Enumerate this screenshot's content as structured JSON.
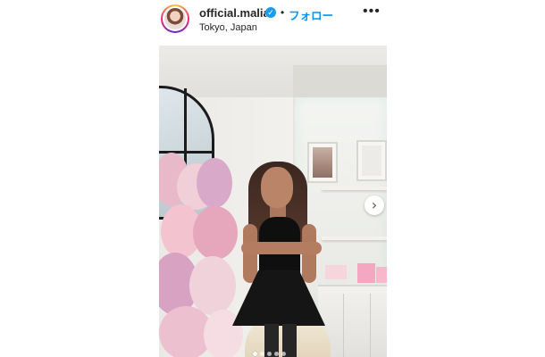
{
  "post_header": {
    "username": "official.malia",
    "verified_mark": "✓",
    "separator": "•",
    "follow_label": "フォロー",
    "location": "Tokyo, Japan",
    "more_icon": "more-horizontal-icon",
    "accent_color": "#0095f6",
    "verified_color": "#1d9bf0"
  },
  "media": {
    "next_icon": "chevron-right-icon",
    "next_glyph": "›",
    "carousel": {
      "total": 5,
      "active_index": 0
    }
  }
}
